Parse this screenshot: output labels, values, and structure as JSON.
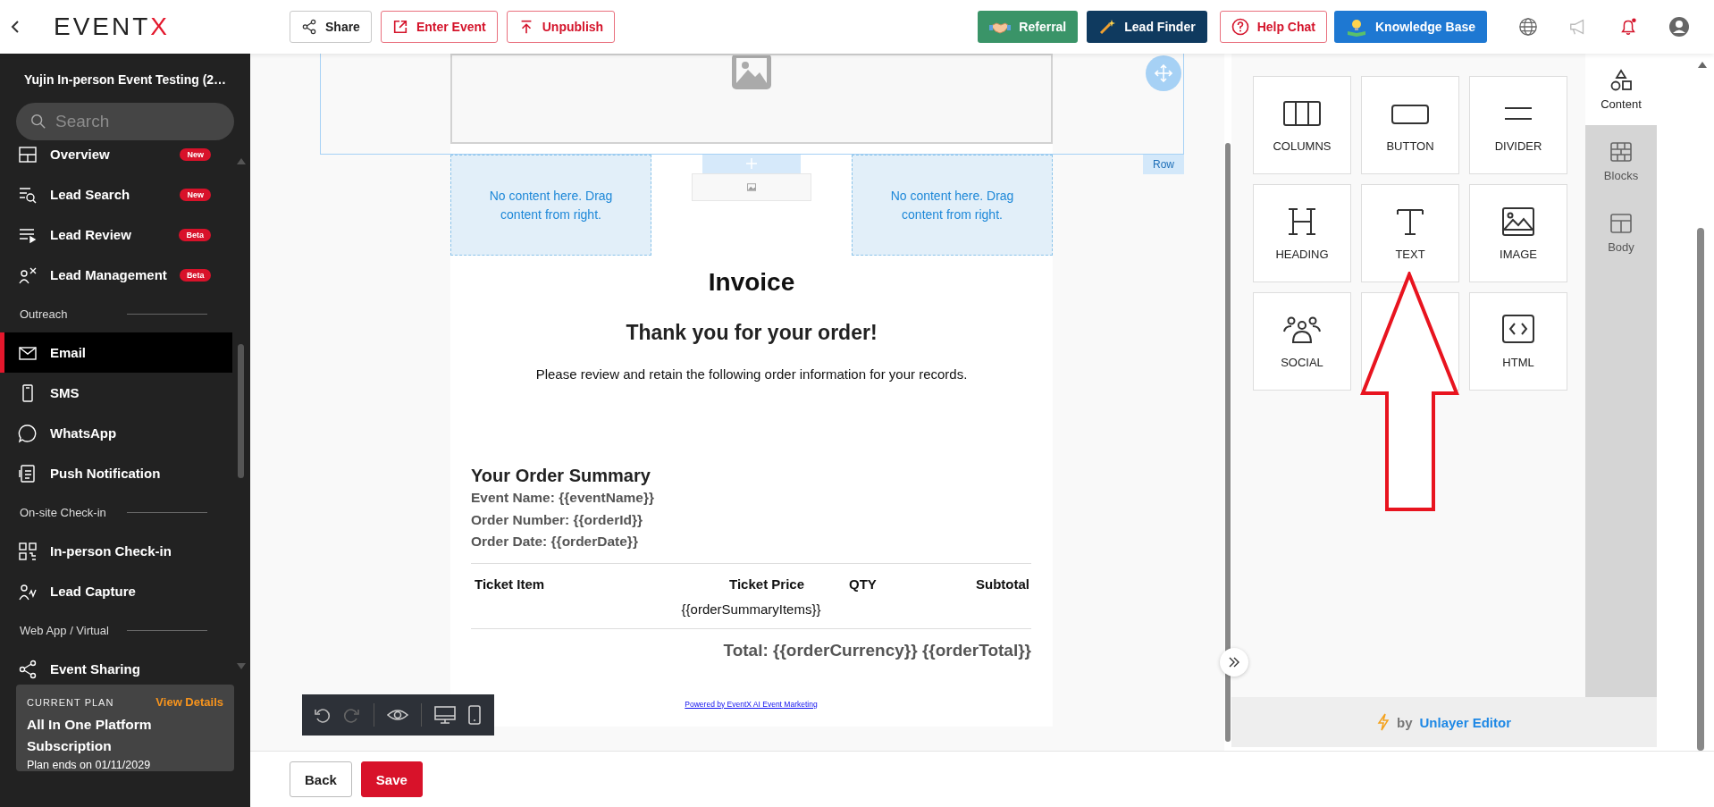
{
  "header": {
    "logo": {
      "text": "EVENT",
      "accent": "X"
    },
    "left_buttons": [
      {
        "label": "Share",
        "kind": "outline"
      },
      {
        "label": "Enter Event",
        "kind": "danger"
      },
      {
        "label": "Unpublish",
        "kind": "danger"
      }
    ],
    "right_buttons": [
      {
        "label": "Referral",
        "kind": "referral"
      },
      {
        "label": "Lead Finder",
        "kind": "finder"
      },
      {
        "label": "Help Chat",
        "kind": "help"
      },
      {
        "label": "Knowledge Base",
        "kind": "knowledge"
      }
    ]
  },
  "sidebar": {
    "event_title": "Yujin In-person Event Testing (2…",
    "search": {
      "placeholder": "Search"
    },
    "items": [
      {
        "kind": "item",
        "label": "Overview",
        "badge": "New",
        "selected": false
      },
      {
        "kind": "item",
        "label": "Lead Search",
        "badge": "New",
        "selected": false
      },
      {
        "kind": "item",
        "label": "Lead Review",
        "badge": "Beta",
        "selected": false
      },
      {
        "kind": "item",
        "label": "Lead Management",
        "badge": "Beta",
        "selected": false
      },
      {
        "kind": "section",
        "label": "Outreach"
      },
      {
        "kind": "item",
        "label": "Email",
        "selected": true
      },
      {
        "kind": "item",
        "label": "SMS",
        "selected": false
      },
      {
        "kind": "item",
        "label": "WhatsApp",
        "selected": false
      },
      {
        "kind": "item",
        "label": "Push Notification",
        "selected": false
      },
      {
        "kind": "section",
        "label": "On-site Check-in"
      },
      {
        "kind": "item",
        "label": "In-person Check-in",
        "selected": false
      },
      {
        "kind": "item",
        "label": "Lead Capture",
        "selected": false
      },
      {
        "kind": "section",
        "label": "Web App / Virtual"
      },
      {
        "kind": "item",
        "label": "Event Sharing",
        "selected": false
      }
    ],
    "plan": {
      "caption": "CURRENT PLAN",
      "link": "View Details",
      "name": "All In One Platform Subscription",
      "ends": "Plan ends on 01/11/2029"
    }
  },
  "email": {
    "drop_zones": [
      {
        "text": "No content here. Drag content from right."
      },
      {
        "text": "No content here. Drag content from right."
      }
    ],
    "row_label": "Row",
    "title": "Invoice",
    "subtitle": "Thank you for your order!",
    "intro": "Please review and retain the following order information for your records.",
    "summary": {
      "heading": "Your Order Summary",
      "lines": [
        "Event Name: {{eventName}}",
        "Order Number: {{orderId}}",
        "Order Date: {{orderDate}}"
      ]
    },
    "table": {
      "columns": [
        "Ticket Item",
        "Ticket Price",
        "QTY",
        "Subtotal"
      ],
      "items": "{{orderSummaryItems}}"
    },
    "total": "Total: {{orderCurrency}} {{orderTotal}}",
    "powered_by": "Powered by EventX AI Event Marketing"
  },
  "tools_panel": {
    "tools": [
      {
        "kind": "tool",
        "label": "COLUMNS"
      },
      {
        "kind": "tool",
        "label": "BUTTON"
      },
      {
        "kind": "tool",
        "label": "DIVIDER"
      },
      {
        "kind": "tool",
        "label": "HEADING"
      },
      {
        "kind": "tool",
        "label": "TEXT"
      },
      {
        "kind": "tool",
        "label": "IMAGE"
      },
      {
        "kind": "tool",
        "label": "SOCIAL"
      },
      {
        "kind": "blank"
      },
      {
        "kind": "tool",
        "label": "HTML"
      }
    ],
    "tabs": [
      {
        "label": "Content",
        "selected": true
      },
      {
        "label": "Blocks",
        "selected": false
      },
      {
        "label": "Body",
        "selected": false
      }
    ],
    "credit": {
      "prefix": "by",
      "link": "Unlayer Editor"
    }
  },
  "footer": {
    "buttons": [
      {
        "label": "Back",
        "kind": "outline"
      },
      {
        "label": "Save",
        "kind": "primary"
      }
    ]
  }
}
